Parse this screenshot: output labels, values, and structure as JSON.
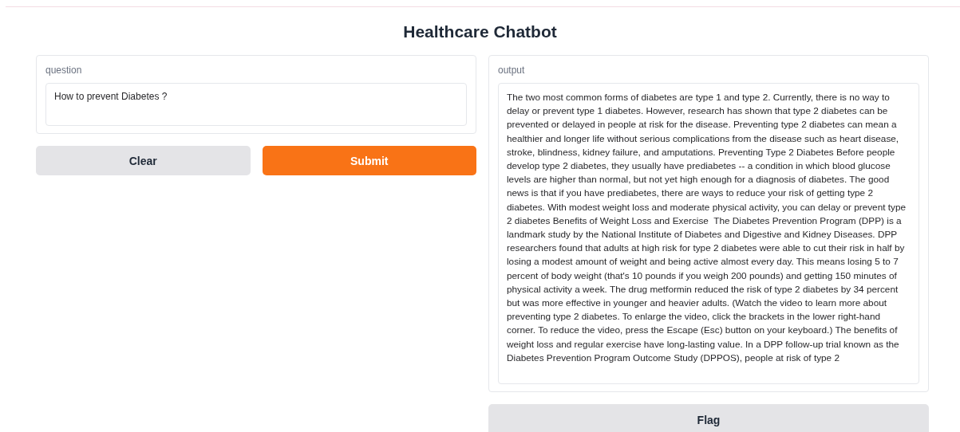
{
  "title": "Healthcare Chatbot",
  "question": {
    "label": "question",
    "value": "How to prevent Diabetes ?"
  },
  "buttons": [
    {
      "label": "Clear",
      "kind": "secondary"
    },
    {
      "label": "Submit",
      "kind": "primary"
    }
  ],
  "output": {
    "label": "output",
    "value": "The two most common forms of diabetes are type 1 and type 2. Currently, there is no way to delay or prevent type 1 diabetes. However, research has shown that type 2 diabetes can be prevented or delayed in people at risk for the disease. Preventing type 2 diabetes can mean a healthier and longer life without serious complications from the disease such as heart disease, stroke, blindness, kidney failure, and amputations. Preventing Type 2 Diabetes Before people develop type 2 diabetes, they usually have prediabetes -- a condition in which blood glucose levels are higher than normal, but not yet high enough for a diagnosis of diabetes. The good news is that if you have prediabetes, there are ways to reduce your risk of getting type 2 diabetes. With modest weight loss and moderate physical activity, you can delay or prevent type 2 diabetes Benefits of Weight Loss and Exercise  The Diabetes Prevention Program (DPP) is a landmark study by the National Institute of Diabetes and Digestive and Kidney Diseases. DPP researchers found that adults at high risk for type 2 diabetes were able to cut their risk in half by losing a modest amount of weight and being active almost every day. This means losing 5 to 7 percent of body weight (that's 10 pounds if you weigh 200 pounds) and getting 150 minutes of physical activity a week. The drug metformin reduced the risk of type 2 diabetes by 34 percent but was more effective in younger and heavier adults. (Watch the video to learn more about preventing type 2 diabetes. To enlarge the video, click the brackets in the lower right-hand corner. To reduce the video, press the Escape (Esc) button on your keyboard.) The benefits of weight loss and regular exercise have long-lasting value. In a DPP follow-up trial known as the Diabetes Prevention Program Outcome Study (DPPOS), people at risk of type 2"
  },
  "flag_button": {
    "label": "Flag"
  }
}
